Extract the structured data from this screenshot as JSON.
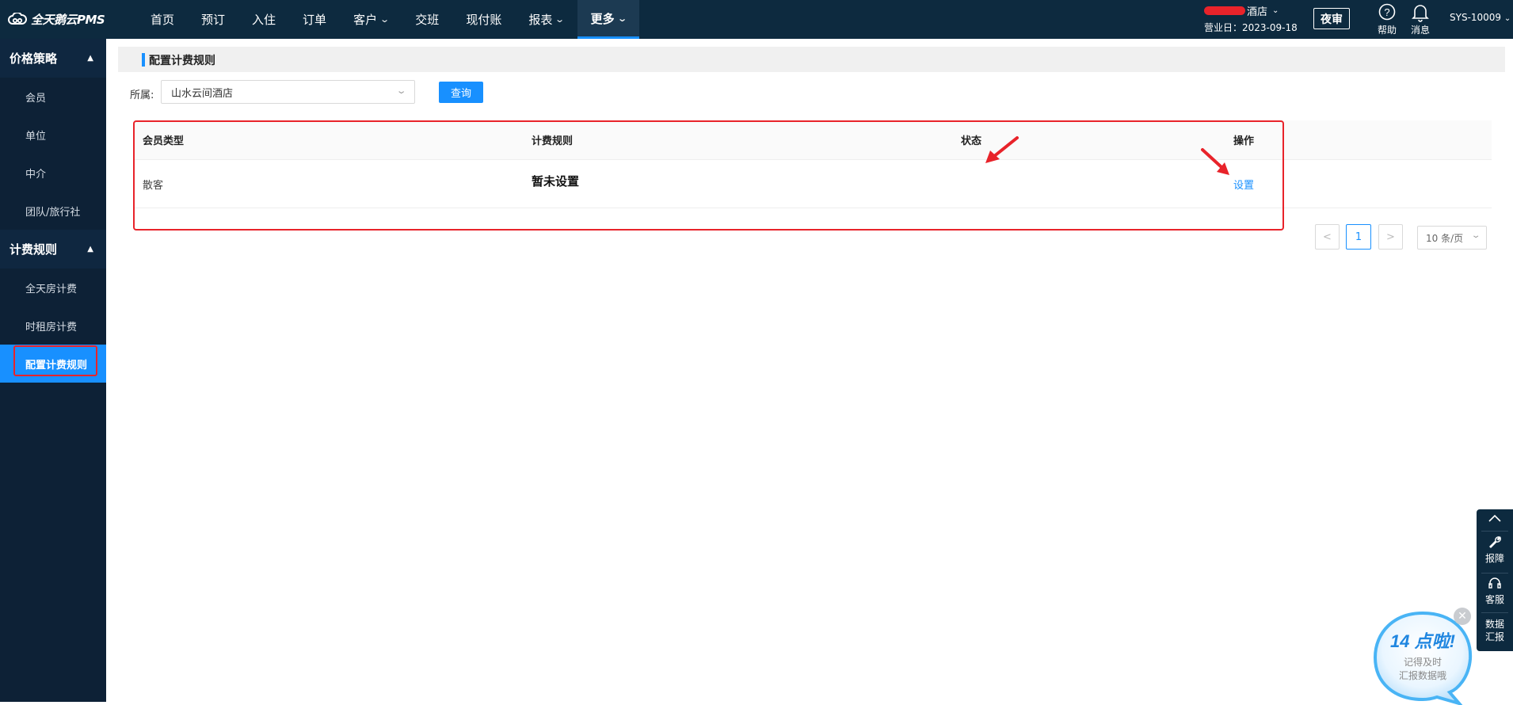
{
  "app": {
    "logo_text": "全天鹅云PMS"
  },
  "nav": {
    "items": [
      {
        "label": "首页"
      },
      {
        "label": "预订"
      },
      {
        "label": "入住"
      },
      {
        "label": "订单"
      },
      {
        "label": "客户",
        "has_dropdown": true
      },
      {
        "label": "交班"
      },
      {
        "label": "现付账"
      },
      {
        "label": "报表",
        "has_dropdown": true
      },
      {
        "label": "更多",
        "has_dropdown": true,
        "active": true
      }
    ]
  },
  "header": {
    "hotel_suffix": "酒店",
    "business_date": "营业日：2023-09-18",
    "night_audit": "夜审",
    "help_label": "帮助",
    "messages_label": "消息",
    "user": "SYS-10009"
  },
  "sidebar": {
    "groups": [
      {
        "label": "价格策略",
        "items": [
          "会员",
          "单位",
          "中介",
          "团队/旅行社"
        ]
      },
      {
        "label": "计费规则",
        "items": [
          "全天房计费",
          "时租房计费",
          "配置计费规则"
        ]
      }
    ],
    "active_item": "配置计费规则"
  },
  "page": {
    "title": "配置计费规则",
    "filter_label": "所属:",
    "filter_value": "山水云间酒店",
    "query_button": "查询"
  },
  "table": {
    "columns": [
      "会员类型",
      "计费规则",
      "状态",
      "操作"
    ],
    "rows": [
      {
        "member_type": "散客",
        "rule": "暂未设置",
        "status": "",
        "action": "设置"
      }
    ]
  },
  "pagination": {
    "prev": "<",
    "current": "1",
    "next": ">",
    "page_size": "10 条/页"
  },
  "float_toolbar": {
    "items": [
      "报障",
      "客服",
      "数据汇报"
    ]
  },
  "reminder": {
    "headline": "14 点啦!",
    "line1": "记得及时",
    "line2": "汇报数据哦"
  },
  "colors": {
    "topbar": "#0d2a3f",
    "sidebar": "#0d2136",
    "accent": "#1890ff",
    "highlight_red": "#e8232a"
  }
}
